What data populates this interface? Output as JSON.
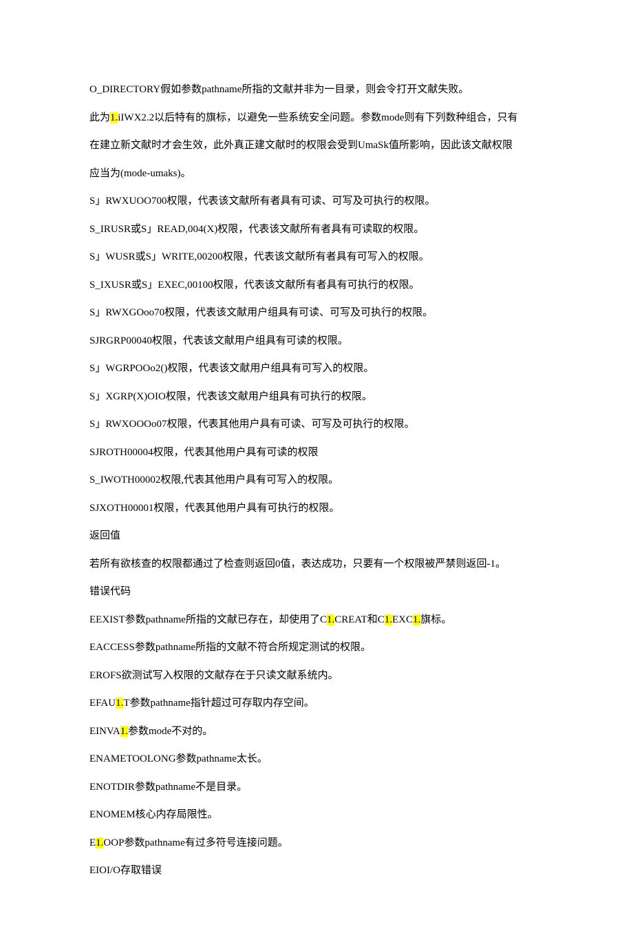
{
  "lines": [
    {
      "segments": [
        {
          "t": "O_DIRECTORY假如参数pathname所指的文献并非为一目录，则会令打开文献失败。"
        }
      ]
    },
    {
      "segments": [
        {
          "t": "此为"
        },
        {
          "t": "1.",
          "hl": true
        },
        {
          "t": "iIWX2.2以后特有的旗标，以避免一些系统安全问题。参数mode则有下列数种组合，只有"
        }
      ]
    },
    {
      "segments": [
        {
          "t": "在建立新文献时才会生效，此外真正建文献时的权限会受到UmaSk值所影响，因此该文献权限"
        }
      ]
    },
    {
      "segments": [
        {
          "t": "应当为(mode-umaks)。"
        }
      ]
    },
    {
      "segments": [
        {
          "t": "S」RWXUOO700权限，代表该文献所有者具有可读、可写及可执行的权限。"
        }
      ]
    },
    {
      "segments": [
        {
          "t": "S_IRUSR或S」READ,004(X)权限，代表该文献所有者具有可读取的权限。"
        }
      ]
    },
    {
      "segments": [
        {
          "t": "S」WUSR或S」WRITE,00200权限，代表该文献所有者具有可写入的权限。"
        }
      ]
    },
    {
      "segments": [
        {
          "t": "S_IXUSR或S」EXEC,00100权限，代表该文献所有者具有可执行的权限。"
        }
      ]
    },
    {
      "segments": [
        {
          "t": "S」RWXGOoo70权限，代表该文献用户组具有可读、可写及可执行的权限。"
        }
      ]
    },
    {
      "segments": [
        {
          "t": "SJRGRP00040权限，代表该文献用户组具有可读的权限。"
        }
      ]
    },
    {
      "segments": [
        {
          "t": "S」WGRPOOo2()权限，代表该文献用户组具有可写入的权限。"
        }
      ]
    },
    {
      "segments": [
        {
          "t": "S」XGRP(X)OIO权限，代表该文献用户组具有可执行的权限。"
        }
      ]
    },
    {
      "segments": [
        {
          "t": "S」RWXOOOo07权限，代表其他用户具有可读、可写及可执行的权限。"
        }
      ]
    },
    {
      "segments": [
        {
          "t": "SJROTH00004权限，代表其他用户具有可读的权限"
        }
      ]
    },
    {
      "segments": [
        {
          "t": "S_IWOTH00002权限,代表其他用户具有可写入的权限。"
        }
      ]
    },
    {
      "segments": [
        {
          "t": "SJXOTH00001权限，代表其他用户具有可执行的权限。"
        }
      ]
    },
    {
      "segments": [
        {
          "t": "返回值"
        }
      ]
    },
    {
      "segments": [
        {
          "t": "若所有欲核查的权限都通过了检查则返回0值，表达成功，只要有一个权限被严禁则返回-1。"
        }
      ]
    },
    {
      "segments": [
        {
          "t": "错误代码"
        }
      ]
    },
    {
      "segments": [
        {
          "t": "EEXIST参数pathname所指的文献已存在，却使用了C"
        },
        {
          "t": "1.",
          "hl": true
        },
        {
          "t": "CREAT和C"
        },
        {
          "t": "1.",
          "hl": true
        },
        {
          "t": "EXC"
        },
        {
          "t": "1.",
          "hl": true
        },
        {
          "t": "旗标。"
        }
      ]
    },
    {
      "segments": [
        {
          "t": "EACCESS参数pathname所指的文献不符合所规定测试的权限。"
        }
      ]
    },
    {
      "segments": [
        {
          "t": "EROFS欲测试写入权限的文献存在于只读文献系统内。"
        }
      ]
    },
    {
      "segments": [
        {
          "t": "EFAU"
        },
        {
          "t": "1.",
          "hl": true
        },
        {
          "t": "T参数pathname指针超过可存取内存空间。"
        }
      ]
    },
    {
      "segments": [
        {
          "t": "EINVA"
        },
        {
          "t": "1.",
          "hl": true
        },
        {
          "t": "参数mode不对的。"
        }
      ]
    },
    {
      "segments": [
        {
          "t": "ENAMETOOLONG参数pathname太长。"
        }
      ]
    },
    {
      "segments": [
        {
          "t": "ENOTDIR参数pathname不是目录。"
        }
      ]
    },
    {
      "segments": [
        {
          "t": "ENOMEM核心内存局限性。"
        }
      ]
    },
    {
      "segments": [
        {
          "t": "E"
        },
        {
          "t": "1.",
          "hl": true
        },
        {
          "t": "OOP参数pathname有过多符号连接问题。"
        }
      ]
    },
    {
      "segments": [
        {
          "t": "EIOI/O存取错误"
        }
      ]
    }
  ]
}
